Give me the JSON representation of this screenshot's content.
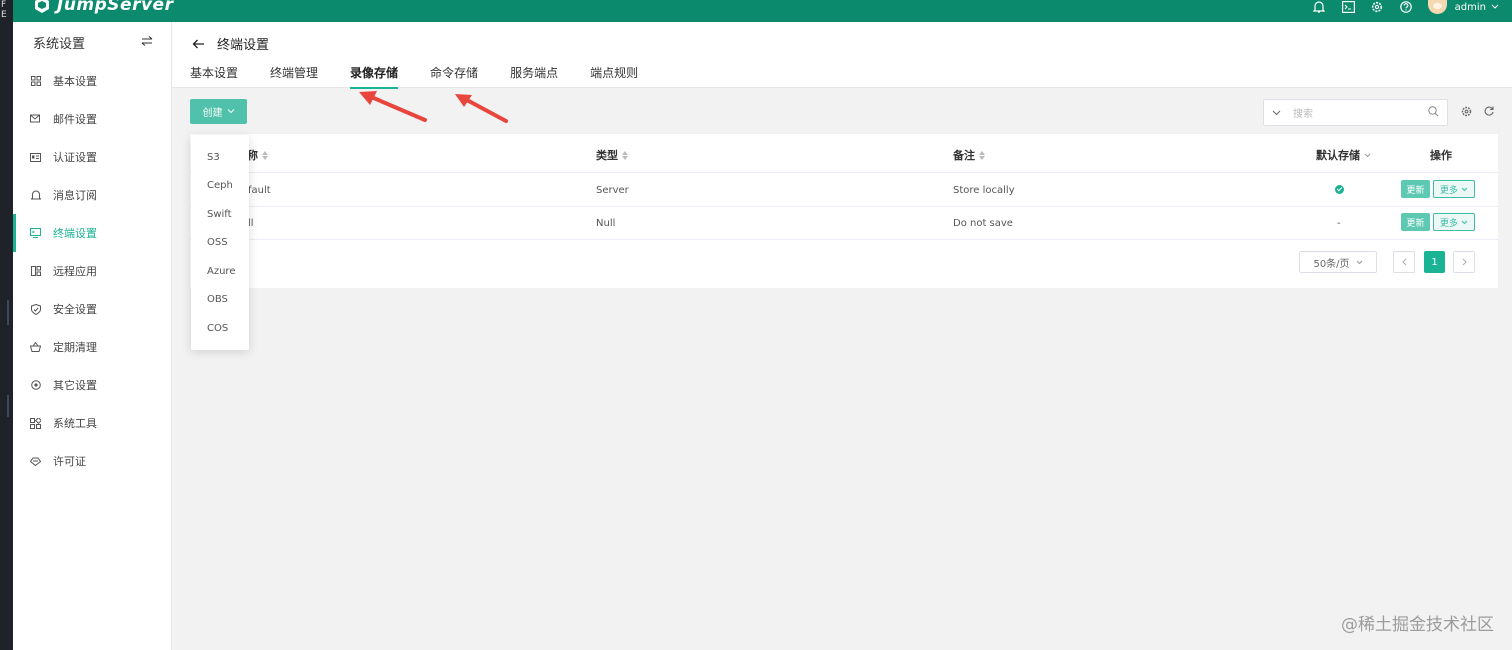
{
  "left_strip": {
    "text": "F E"
  },
  "app": {
    "logo": "JumpServer",
    "user": "admin"
  },
  "sidebar": {
    "title": "系统设置",
    "items": [
      {
        "label": "基本设置",
        "icon": "grid-icon"
      },
      {
        "label": "邮件设置",
        "icon": "mail-icon"
      },
      {
        "label": "认证设置",
        "icon": "id-card-icon"
      },
      {
        "label": "消息订阅",
        "icon": "bell-icon"
      },
      {
        "label": "终端设置",
        "icon": "monitor-icon",
        "active": true
      },
      {
        "label": "远程应用",
        "icon": "apps-icon"
      },
      {
        "label": "安全设置",
        "icon": "shield-icon"
      },
      {
        "label": "定期清理",
        "icon": "basket-icon"
      },
      {
        "label": "其它设置",
        "icon": "target-icon"
      },
      {
        "label": "系统工具",
        "icon": "tools-icon"
      },
      {
        "label": "许可证",
        "icon": "license-icon"
      }
    ]
  },
  "page": {
    "title": "终端设置",
    "tabs": [
      {
        "label": "基本设置"
      },
      {
        "label": "终端管理"
      },
      {
        "label": "录像存储",
        "active": true
      },
      {
        "label": "命令存储"
      },
      {
        "label": "服务端点"
      },
      {
        "label": "端点规则"
      }
    ]
  },
  "toolbar": {
    "create_label": "创建",
    "search_placeholder": "搜索"
  },
  "table": {
    "headers": {
      "name": "名称",
      "name_visible": "称",
      "type": "类型",
      "comment": "备注",
      "default": "默认存储",
      "actions": "操作"
    },
    "rows": [
      {
        "name_visible": "fault",
        "type": "Server",
        "comment": "Store locally",
        "default": true,
        "default_text": ""
      },
      {
        "name_visible": "ll",
        "type": "Null",
        "comment": "Do not save",
        "default": false,
        "default_text": "-"
      }
    ],
    "update_label": "更新",
    "more_label": "更多"
  },
  "pagination": {
    "page_size": "50条/页",
    "current": "1"
  },
  "dropdown": {
    "items": [
      "S3",
      "Ceph",
      "Swift",
      "OSS",
      "Azure",
      "OBS",
      "COS"
    ]
  },
  "watermark": "@稀土掘金技术社区",
  "colors": {
    "topbar": "#0c8a6d",
    "accent": "#1ab394",
    "annotation_arrow": "#e8453c"
  }
}
